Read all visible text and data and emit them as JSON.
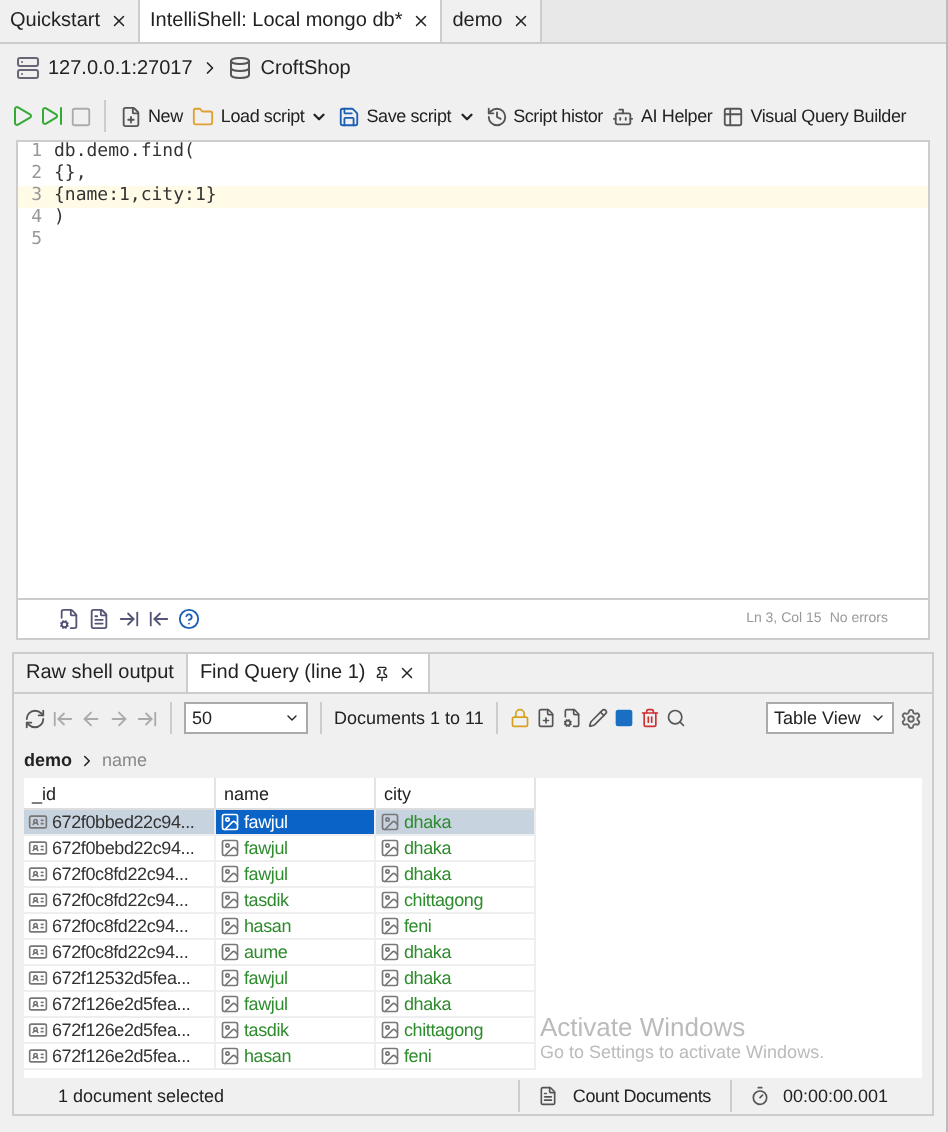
{
  "tabs": [
    {
      "label": "Quickstart",
      "selected": false
    },
    {
      "label": "IntelliShell: Local mongo db*",
      "selected": true
    },
    {
      "label": "demo",
      "selected": false
    }
  ],
  "breadcrumb": {
    "server": "127.0.0.1:27017",
    "database": "CroftShop"
  },
  "toolbar": [
    {
      "label": "New",
      "kind": "new",
      "dropdown": false
    },
    {
      "label": "Load script",
      "kind": "folder",
      "dropdown": true
    },
    {
      "label": "Save script",
      "kind": "save",
      "dropdown": true
    },
    {
      "label": "Script histor",
      "kind": "history",
      "dropdown": false
    },
    {
      "label": "AI Helper",
      "kind": "ai",
      "dropdown": false
    },
    {
      "label": "Visual Query Builder",
      "kind": "builder",
      "dropdown": false
    }
  ],
  "editor": {
    "lines": [
      {
        "number": "1",
        "code": "db.demo.find(",
        "current": false
      },
      {
        "number": "2",
        "code": "{},",
        "current": false
      },
      {
        "number": "3",
        "code": "{name:1,city:1}",
        "current": true
      },
      {
        "number": "4",
        "code": ")",
        "current": false
      },
      {
        "number": "5",
        "current": false
      }
    ],
    "position": "Ln 3, Col 15",
    "errors": "No errors"
  },
  "result_tabs": [
    {
      "label": "Raw shell output",
      "selected": false
    },
    {
      "label": "Find Query (line 1)",
      "selected": true
    }
  ],
  "result_toolbar": {
    "page_size": "50",
    "documents": "Documents 1 to 11",
    "view": "Table View"
  },
  "path": {
    "collection": "demo",
    "field": "name"
  },
  "table": {
    "columns": [
      "_id",
      "name",
      "city"
    ],
    "rows": [
      {
        "id": "672f0bbed22c94...",
        "name": "fawjul",
        "city": "dhaka",
        "selected": true
      },
      {
        "id": "672f0bebd22c94...",
        "name": "fawjul",
        "city": "dhaka",
        "selected": false
      },
      {
        "id": "672f0c8fd22c94...",
        "name": "fawjul",
        "city": "dhaka",
        "selected": false
      },
      {
        "id": "672f0c8fd22c94...",
        "name": "tasdik",
        "city": "chittagong",
        "selected": false
      },
      {
        "id": "672f0c8fd22c94...",
        "name": "hasan",
        "city": "feni",
        "selected": false
      },
      {
        "id": "672f0c8fd22c94...",
        "name": "aume",
        "city": "dhaka",
        "selected": false
      },
      {
        "id": "672f12532d5fea...",
        "name": "fawjul",
        "city": "dhaka",
        "selected": false
      },
      {
        "id": "672f126e2d5fea...",
        "name": "fawjul",
        "city": "dhaka",
        "selected": false
      },
      {
        "id": "672f126e2d5fea...",
        "name": "tasdik",
        "city": "chittagong",
        "selected": false
      },
      {
        "id": "672f126e2d5fea...",
        "name": "hasan",
        "city": "feni",
        "selected": false
      }
    ]
  },
  "status_bar": {
    "selection": "1 document selected",
    "count": "Count Documents",
    "time": "00:00:00.001"
  },
  "os_notice": {
    "title": "Activate Windows",
    "text": "Go to Settings to activate Windows."
  }
}
